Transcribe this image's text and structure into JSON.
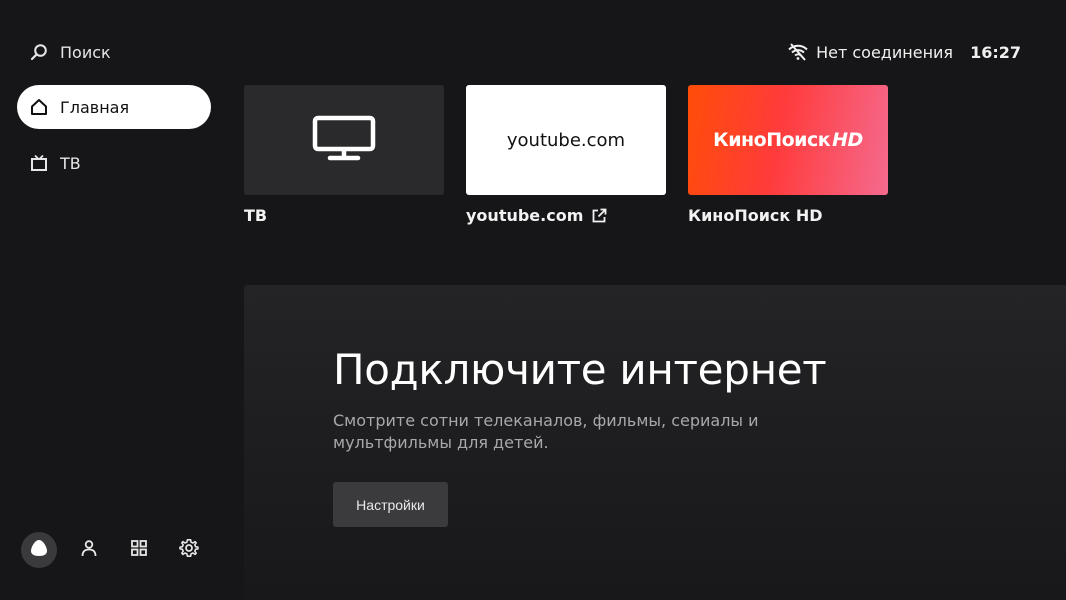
{
  "sidebar": {
    "search_label": "Поиск",
    "items": [
      {
        "label": "Главная",
        "icon": "home-icon",
        "active": true
      },
      {
        "label": "ТВ",
        "icon": "tv-icon",
        "active": false
      }
    ],
    "bottom_icons": [
      "alice-icon",
      "profile-icon",
      "apps-icon",
      "settings-icon"
    ]
  },
  "status": {
    "connection": "Нет соединения",
    "time": "16:27",
    "icon": "wifi-off-icon"
  },
  "tiles": [
    {
      "caption": "ТВ",
      "icon": "monitor-icon"
    },
    {
      "caption": "youtube.com",
      "tile_text": "youtube.com",
      "icon": "external-link-icon"
    },
    {
      "caption": "КиноПоиск HD",
      "logo_main": "КиноПоиск",
      "logo_hd": "HD"
    }
  ],
  "banner": {
    "title": "Подключите интернет",
    "text": "Смотрите сотни телеканалов, фильмы, сериалы и мультфильмы для детей.",
    "button_label": "Настройки"
  },
  "colors": {
    "background": "#161618",
    "active_item": "#ffffff",
    "kinopoisk_gradient_start": "#ff4d08",
    "kinopoisk_gradient_end": "#f56a8e"
  }
}
